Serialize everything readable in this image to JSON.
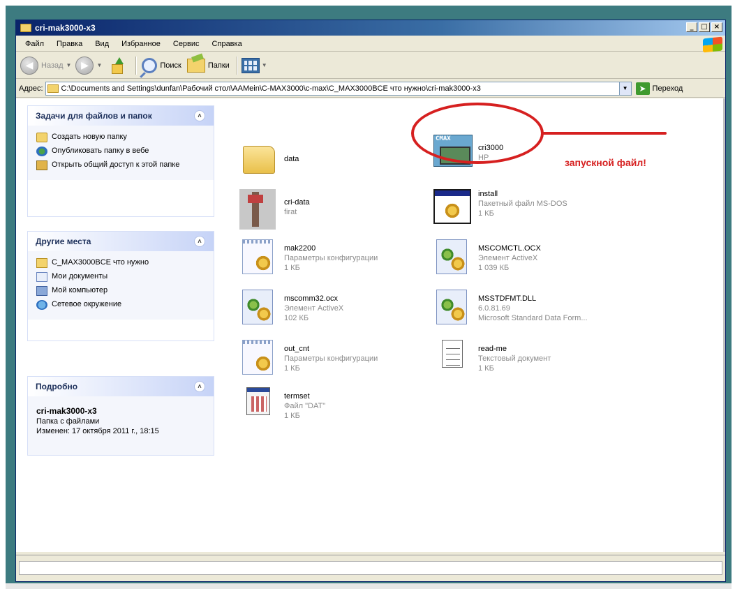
{
  "window": {
    "title": "cri-mak3000-x3",
    "buttons": {
      "minimize": "_",
      "maximize": "□",
      "close": "×"
    }
  },
  "menu": [
    "Файл",
    "Правка",
    "Вид",
    "Избранное",
    "Сервис",
    "Справка"
  ],
  "toolbar": {
    "back_label": "Назад",
    "search_label": "Поиск",
    "folders_label": "Папки"
  },
  "address": {
    "label": "Адрес:",
    "path": "C:\\Documents and Settings\\dunfan\\Рабочий стол\\AAMein\\C-MAX3000\\c-max\\C_MAX3000BCE что нужно\\cri-mak3000-x3",
    "go_label": "Переход"
  },
  "panels": {
    "tasks": {
      "title": "Задачи для файлов и папок",
      "items": [
        "Создать новую папку",
        "Опубликовать папку в вебе",
        "Открыть общий доступ к этой папке"
      ]
    },
    "places": {
      "title": "Другие места",
      "items": [
        "C_MAX3000BCE что нужно",
        "Мои документы",
        "Мой компьютер",
        "Сетевое окружение"
      ]
    },
    "details": {
      "title": "Подробно",
      "name": "cri-mak3000-x3",
      "type": "Папка с файлами",
      "modified": "Изменен: 17 октября 2011 г., 18:15"
    }
  },
  "files": [
    {
      "name": "data",
      "type": "",
      "size": "",
      "icon": "folder-icon"
    },
    {
      "name": "cri3000",
      "type": "HP",
      "size": "",
      "icon": "cmax-app-icon"
    },
    {
      "name": "cri-data",
      "type": "firat",
      "size": "",
      "icon": "injector-icon"
    },
    {
      "name": "install",
      "type": "Пакетный файл MS-DOS",
      "size": "1 КБ",
      "icon": "batch-file-icon"
    },
    {
      "name": "mak2200",
      "type": "Параметры конфигурации",
      "size": "1 КБ",
      "icon": "config-file-icon"
    },
    {
      "name": "MSCOMCTL.OCX",
      "type": "Элемент ActiveX",
      "size": "1 039 КБ",
      "icon": "activex-icon"
    },
    {
      "name": "mscomm32.ocx",
      "type": "Элемент ActiveX",
      "size": "102 КБ",
      "icon": "activex-icon"
    },
    {
      "name": "MSSTDFMT.DLL",
      "type": "6.0.81.69",
      "size": "Microsoft Standard Data Form...",
      "icon": "dll-icon"
    },
    {
      "name": "out_cnt",
      "type": "Параметры конфигурации",
      "size": "1 КБ",
      "icon": "config-file-icon"
    },
    {
      "name": "read-me",
      "type": "Текстовый документ",
      "size": "1 КБ",
      "icon": "text-file-icon"
    },
    {
      "name": "termset",
      "type": "Файл \"DAT\"",
      "size": "1 КБ",
      "icon": "dat-file-icon"
    }
  ],
  "annotation": "запускной файл!",
  "colors": {
    "annotation": "#d62020",
    "title_bar": "#0a246a",
    "panel_header": "#c6d3f7"
  }
}
